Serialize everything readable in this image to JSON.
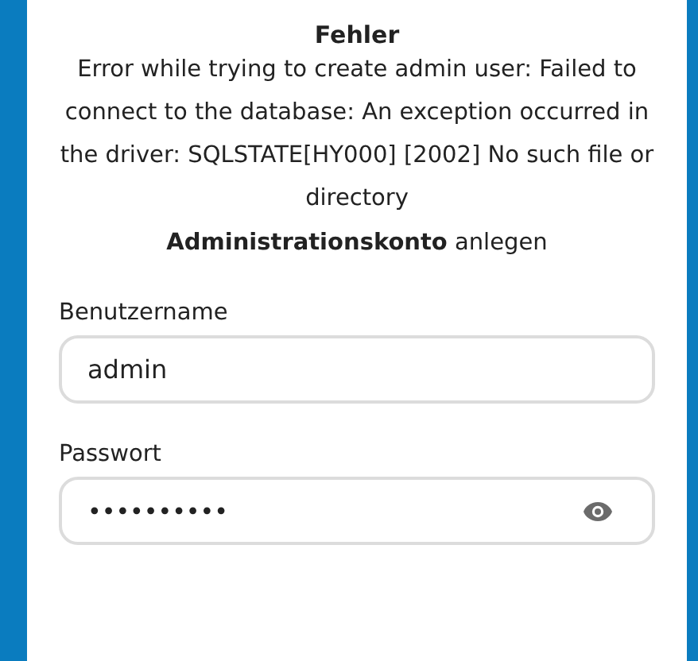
{
  "error": {
    "title": "Fehler",
    "message": "Error while trying to create admin user: Failed to connect to the database: An exception occurred in the driver: SQLSTATE[HY000] [2002] No such file or directory"
  },
  "heading": "**Administrationskonto** anlegen",
  "fields": [
    {
      "label": "Benutzername",
      "value": "admin",
      "kind": "text"
    },
    {
      "label": "Passwort",
      "value": "••••••••••",
      "kind": "password"
    }
  ]
}
